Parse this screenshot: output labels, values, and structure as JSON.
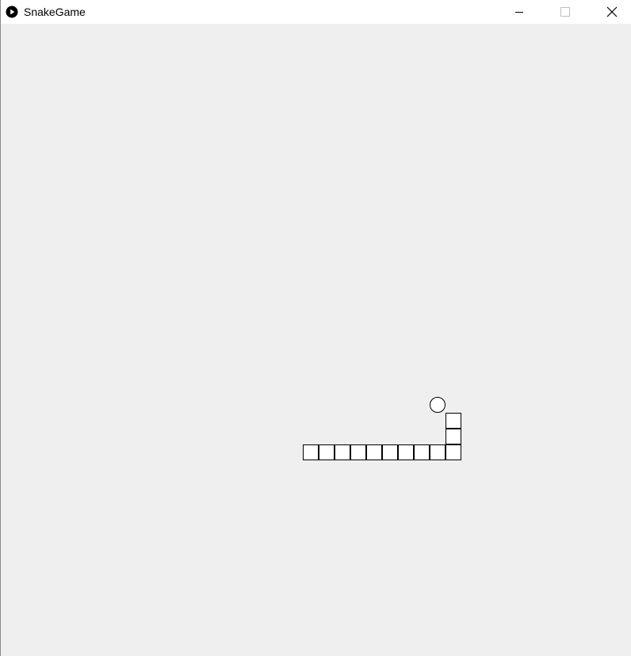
{
  "window": {
    "title": "SnakeGame",
    "icon": "play-icon",
    "controls": [
      "minimize-icon",
      "maximize-icon",
      "close-icon"
    ]
  },
  "game": {
    "background": "#efefef",
    "cell_fill": "#ffffff",
    "cell_stroke": "#000000",
    "grid_cell_units": 1,
    "snake": [
      {
        "col": 19,
        "row": 26
      },
      {
        "col": 20,
        "row": 26
      },
      {
        "col": 21,
        "row": 26
      },
      {
        "col": 22,
        "row": 26
      },
      {
        "col": 23,
        "row": 26
      },
      {
        "col": 24,
        "row": 26
      },
      {
        "col": 25,
        "row": 26
      },
      {
        "col": 26,
        "row": 26
      },
      {
        "col": 27,
        "row": 26
      },
      {
        "col": 28,
        "row": 26
      },
      {
        "col": 28,
        "row": 25
      },
      {
        "col": 28,
        "row": 24
      }
    ],
    "food": {
      "col": 27,
      "row": 23
    }
  }
}
